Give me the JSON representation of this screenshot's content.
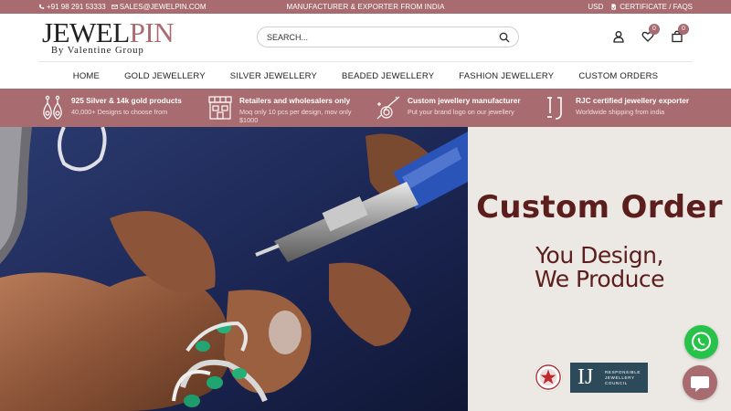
{
  "topbar": {
    "phone": "+91 98 291 53333",
    "email": "SALES@JEWELPIN.COM",
    "tagline": "MANUFACTURER & EXPORTER FROM INDIA",
    "currency": "USD",
    "links": "CERTIFICATE / FAQS"
  },
  "header": {
    "logo_main_a": "JEWEL",
    "logo_main_b": "PIN",
    "logo_sub": "By Valentine Group",
    "search_placeholder": "SEARCH...",
    "wishlist_count": "0",
    "cart_count": "0"
  },
  "nav": {
    "items": [
      "HOME",
      "GOLD JEWELLERY",
      "SILVER JEWELLERY",
      "BEADED JEWELLERY",
      "FASHION JEWELLERY",
      "CUSTOM ORDERS"
    ]
  },
  "features": [
    {
      "title": "925 Silver & 14k gold products",
      "desc": "40,000+ Designs to choose from",
      "icon": "earrings-icon"
    },
    {
      "title": "Retailers and wholesalers only",
      "desc": "Moq only 10 pcs per design, mov only $1000",
      "icon": "store-icon"
    },
    {
      "title": "Custom jewellery manufacturer",
      "desc": "Put your brand logo on our jewellery",
      "icon": "jewellery-tools-icon"
    },
    {
      "title": "RJC certified jewellery exporter",
      "desc": "Worldwide shipping from india",
      "icon": "rjc-icon"
    }
  ],
  "hero": {
    "headline": "Custom Order",
    "line1": "You Design,",
    "line2": "We Produce",
    "rjc_logo_text": "IJ",
    "rjc_text_1": "RESPONSIBLE",
    "rjc_text_2": "JEWELLERY",
    "rjc_text_3": "COUNCIL"
  },
  "colors": {
    "brand": "#a86b6f",
    "headline": "#5c1d1d",
    "whatsapp": "#27c24a",
    "panel": "#ece9e5"
  }
}
